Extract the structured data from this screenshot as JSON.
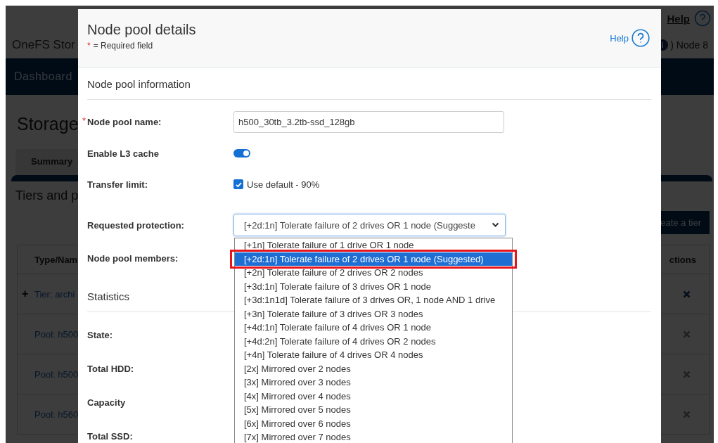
{
  "background_page": {
    "app_title": "OneFS Stor",
    "help_link": "Help",
    "node_label": ") Node 8",
    "nav_item": "Dashboard",
    "page_title": "Storage",
    "tabs": [
      {
        "label": "Summary",
        "selected": true
      }
    ],
    "section_title": "Tiers and p",
    "create_button": "eate a tier",
    "table": {
      "columns": [
        "Type/Nam",
        "ctions"
      ],
      "rows": [
        {
          "expander": "+",
          "name": "Tier: archi",
          "delete_enabled": true
        },
        {
          "name": "Pool: h500",
          "delete_enabled": false
        },
        {
          "name": "Pool: h500",
          "delete_enabled": false
        },
        {
          "name": "Pool: h560",
          "delete_enabled": false
        }
      ]
    }
  },
  "modal": {
    "title": "Node pool details",
    "required_mark": "*",
    "required_note": "= Required field",
    "help_link": "Help",
    "sections": [
      {
        "title": "Node pool information",
        "fields": [
          {
            "kind": "text",
            "label": "Node pool name:",
            "required": true,
            "value": "h500_30tb_3.2tb-ssd_128gb"
          },
          {
            "kind": "toggle",
            "label": "Enable L3 cache",
            "on": true
          },
          {
            "kind": "checkbox",
            "label": "Transfer limit:",
            "checked": true,
            "option_label": "Use default - 90%"
          },
          {
            "kind": "select",
            "label": "Requested protection:",
            "value": "[+2d:1n] Tolerate failure of 2 drives OR 1 node (Suggeste",
            "expanded": true,
            "options": [
              {
                "label": "[+1n] Tolerate failure of 1 drive OR 1 node",
                "selected": false
              },
              {
                "label": "[+2d:1n] Tolerate failure of 2 drives OR 1 node (Suggested)",
                "selected": true
              },
              {
                "label": "[+2n] Tolerate failure of 2 drives OR 2 nodes",
                "selected": false
              },
              {
                "label": "[+3d:1n] Tolerate failure of 3 drives OR 1 node",
                "selected": false
              },
              {
                "label": "[+3d:1n1d] Tolerate failure of 3 drives OR, 1 node AND 1 drive",
                "selected": false
              },
              {
                "label": "[+3n] Tolerate failure of 3 drives OR 3 nodes",
                "selected": false
              },
              {
                "label": "[+4d:1n] Tolerate failure of 4 drives OR 1 node",
                "selected": false
              },
              {
                "label": "[+4d:2n] Tolerate failure of 4 drives OR 2 nodes",
                "selected": false
              },
              {
                "label": "[+4n] Tolerate failure of 4 drives OR 4 nodes",
                "selected": false
              },
              {
                "label": "[2x] Mirrored over 2 nodes",
                "selected": false
              },
              {
                "label": "[3x] Mirrored over 3 nodes",
                "selected": false
              },
              {
                "label": "[4x] Mirrored over 4 nodes",
                "selected": false
              },
              {
                "label": "[5x] Mirrored over 5 nodes",
                "selected": false
              },
              {
                "label": "[6x] Mirrored over 6 nodes",
                "selected": false
              },
              {
                "label": "[7x] Mirrored over 7 nodes",
                "selected": false
              }
            ]
          },
          {
            "kind": "empty",
            "label": "Node pool members:"
          }
        ]
      },
      {
        "title": "Statistics",
        "fields": [
          {
            "kind": "empty",
            "label": "State:"
          },
          {
            "kind": "empty",
            "label": "Total HDD:"
          },
          {
            "kind": "empty",
            "label": "Capacity"
          },
          {
            "kind": "empty",
            "label": "Total SSD:"
          }
        ]
      }
    ]
  }
}
